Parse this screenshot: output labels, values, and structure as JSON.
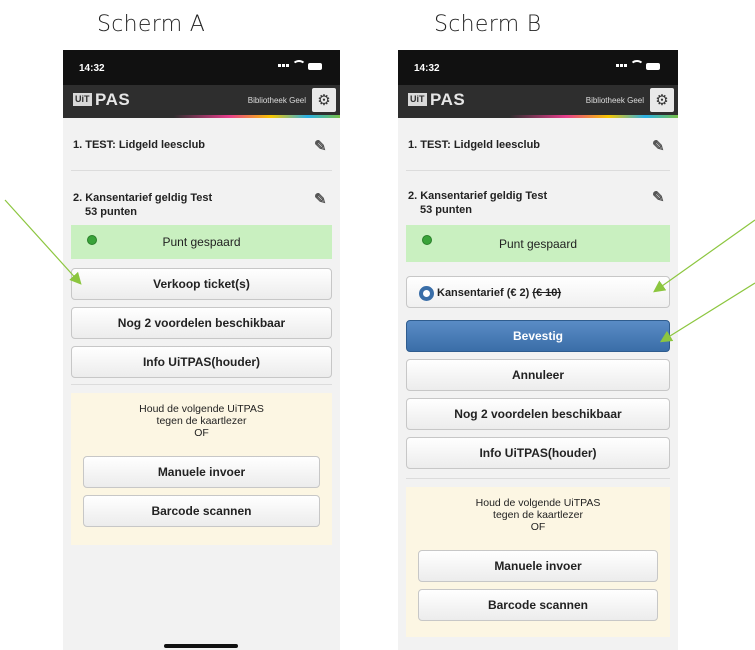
{
  "captions": {
    "a": "Scherm A",
    "b": "Scherm B"
  },
  "status": {
    "time": "14:32"
  },
  "app": {
    "logo_box": "UiT",
    "logo_text": "PAS",
    "venue": "Bibliotheek Geel"
  },
  "items": {
    "first": "1. TEST: Lidgeld leesclub",
    "second": "2. Kansentarief geldig Test",
    "points": "53 punten"
  },
  "notice": "Punt gespaard",
  "screen_a": {
    "sell_ticket": "Verkoop ticket(s)",
    "more_benefits": "Nog 2 voordelen beschikbaar",
    "info": "Info UiTPAS(houder)"
  },
  "screen_b": {
    "option_label": "Kansentarief (€ 2)",
    "option_old_price": "(€ 10)",
    "confirm": "Bevestig",
    "cancel": "Annuleer",
    "more_benefits": "Nog 2 voordelen beschikbaar",
    "info": "Info UiTPAS(houder)"
  },
  "panel": {
    "line1": "Houd de volgende UiTPAS",
    "line2": "tegen de kaartlezer",
    "line3": "OF",
    "manual": "Manuele invoer",
    "scan": "Barcode scannen"
  },
  "icons": {
    "settings": "gear-icon",
    "edit": "edit-icon",
    "success": "check-circle-icon",
    "radio": "radio-selected-icon"
  },
  "colors": {
    "annotation_arrow": "#8cc63f",
    "notice_bg": "#c9f0c0",
    "primary": "#3a6ea8"
  }
}
